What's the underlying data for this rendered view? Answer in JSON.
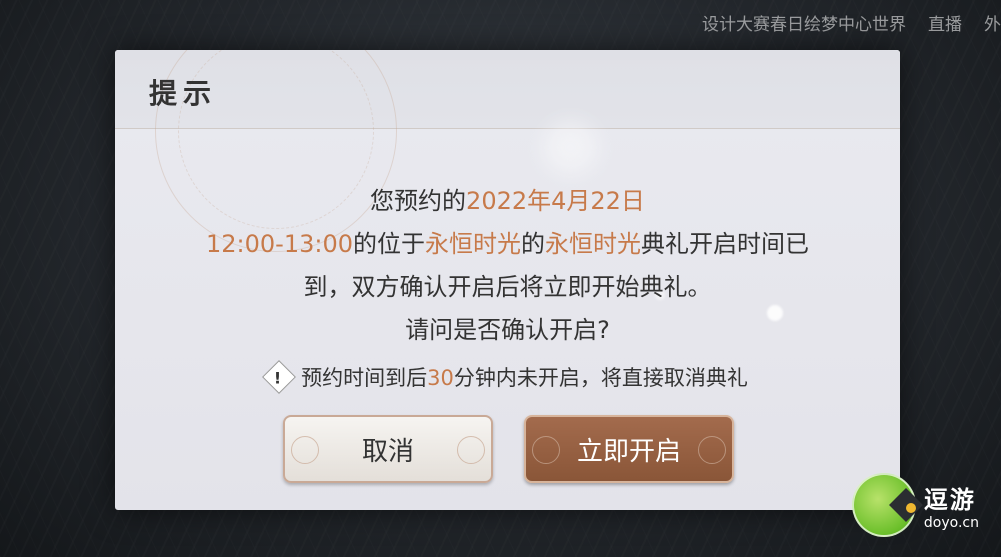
{
  "top_nav": {
    "items": [
      "设计大赛春日绘梦中心世界",
      "直播",
      "外"
    ]
  },
  "dialog": {
    "title": "提示",
    "message": {
      "line1_prefix": "您预约的",
      "line1_date": "2022年4月22日",
      "line2_time": "12:00-13:00",
      "line2_mid1": "的位于",
      "line2_place": "永恒时光",
      "line2_mid2": "的",
      "line2_ceremony": "永恒时光",
      "line2_suffix": "典礼开启时间已",
      "line3": "到，双方确认开启后将立即开始典礼。",
      "line4": "请问是否确认开启?"
    },
    "warning": {
      "icon": "!",
      "prefix": "预约时间到后",
      "minutes": "30",
      "suffix": "分钟内未开启，将直接取消典礼"
    },
    "buttons": {
      "cancel": "取消",
      "confirm": "立即开启"
    }
  },
  "watermark": {
    "cn": "逗游",
    "en": "doyo.cn"
  },
  "colors": {
    "accent": "#c77a4a",
    "confirm_button": "#8a5638",
    "logo_green": "#6bbf2a"
  }
}
